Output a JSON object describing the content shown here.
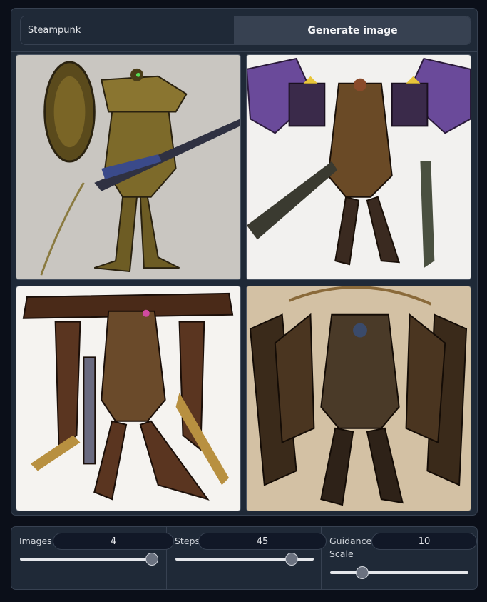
{
  "prompt": {
    "value": "Steampunk",
    "placeholder": ""
  },
  "generate_button": {
    "label": "Generate image"
  },
  "gallery": {
    "images": [
      {
        "alt": "",
        "background": "#c9c6c1"
      },
      {
        "alt": "",
        "background": "#f2f1ef"
      },
      {
        "alt": "",
        "background": "#f5f3f0"
      },
      {
        "alt": "",
        "background": "#cdbb9f"
      }
    ]
  },
  "controls": {
    "images": {
      "label": "Images",
      "value": "4",
      "fraction": 0.95
    },
    "steps": {
      "label": "Steps",
      "value": "45",
      "fraction": 0.85
    },
    "guidance": {
      "label": "Guidance Scale",
      "value": "10",
      "fraction": 0.23
    }
  },
  "colors": {
    "background": "#0b0f19",
    "panel": "#1f2937",
    "border": "#374151",
    "button": "#374151"
  }
}
